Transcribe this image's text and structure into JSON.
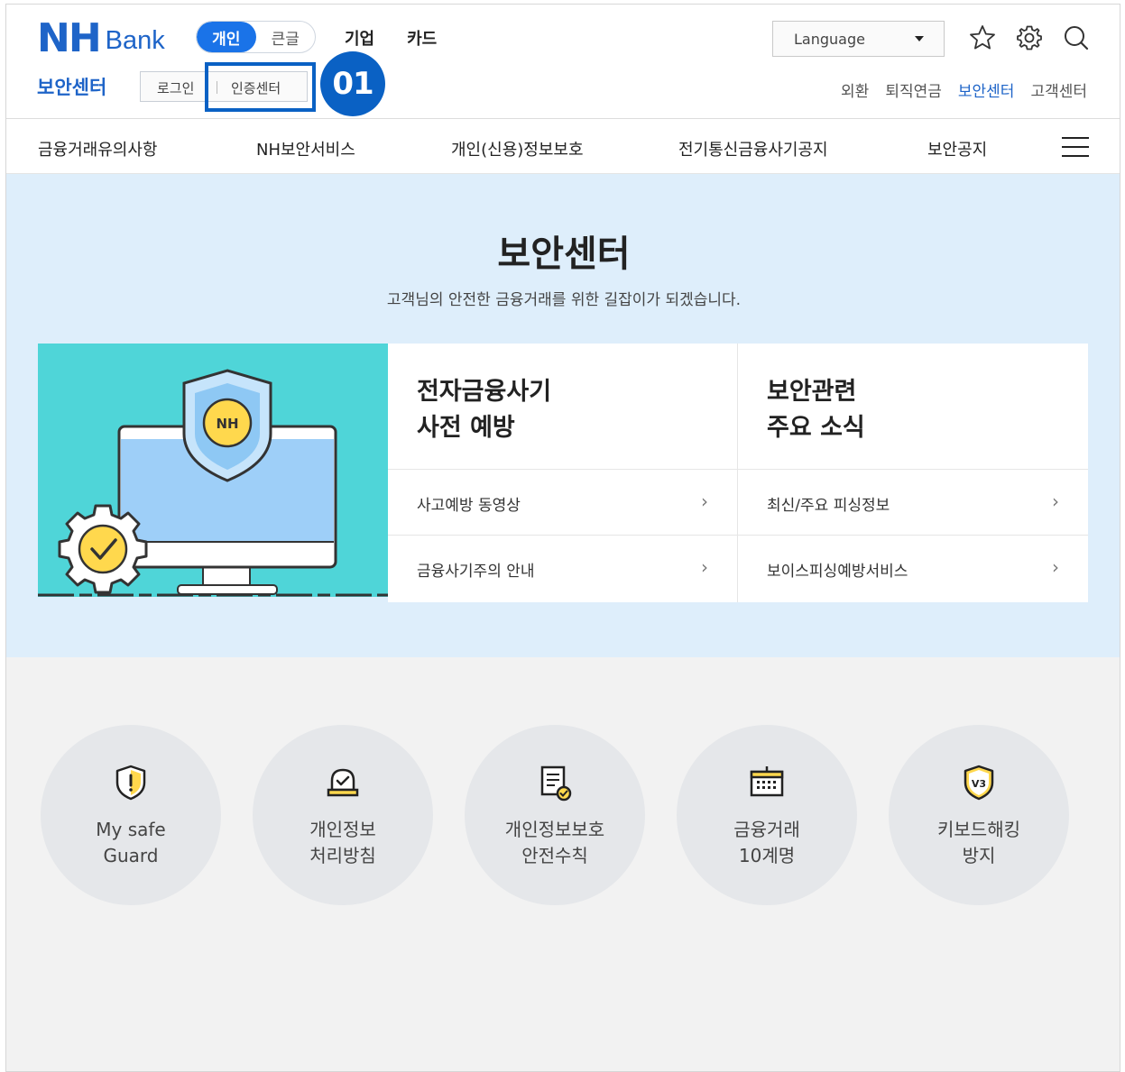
{
  "header": {
    "logo_nh": "NH",
    "logo_bank": "Bank",
    "segment": [
      "개인",
      "큰글"
    ],
    "topnav": [
      "기업",
      "카드"
    ],
    "page_sub": "보안센터",
    "auth": {
      "login": "로그인",
      "cert": "인증센터"
    },
    "callout_badge": "01",
    "language": "Language",
    "icons": [
      "star-icon",
      "gear-icon",
      "search-icon"
    ],
    "util": [
      "외환",
      "퇴직연금",
      "보안센터",
      "고객센터"
    ],
    "accent": "#1e64c8",
    "callout_color": "#0a61c4"
  },
  "gnb": {
    "items": [
      "금융거래유의사항",
      "NH보안서비스",
      "개인(신용)정보보호",
      "전기통신금융사기공지",
      "보안공지"
    ],
    "menu_icon": "hamburger-icon"
  },
  "hero": {
    "title": "보안센터",
    "desc": "고객님의 안전한 금융거래를 위한 길잡이가 되겠습니다.",
    "illustration_badge": "NH",
    "cards": [
      {
        "title_line1": "전자금융사기",
        "title_line2": "사전 예방",
        "links": [
          "사고예방 동영상",
          "금융사기주의 안내"
        ]
      },
      {
        "title_line1": "보안관련",
        "title_line2": "주요 소식",
        "links": [
          "최신/주요 피싱정보",
          "보이스피싱예방서비스"
        ]
      }
    ],
    "background": "#deeefb",
    "illustration_bg": "#4fd5d8"
  },
  "quick": {
    "items": [
      {
        "line1": "My safe",
        "line2": "Guard",
        "icon": "shield-alert-icon"
      },
      {
        "line1": "개인정보",
        "line2": "처리방침",
        "icon": "alarm-check-icon"
      },
      {
        "line1": "개인정보보호",
        "line2": "안전수칙",
        "icon": "document-check-icon"
      },
      {
        "line1": "금융거래",
        "line2": "10계명",
        "icon": "keyboard-calendar-icon"
      },
      {
        "line1": "키보드해킹",
        "line2": "방지",
        "icon": "v3-shield-icon"
      }
    ]
  }
}
